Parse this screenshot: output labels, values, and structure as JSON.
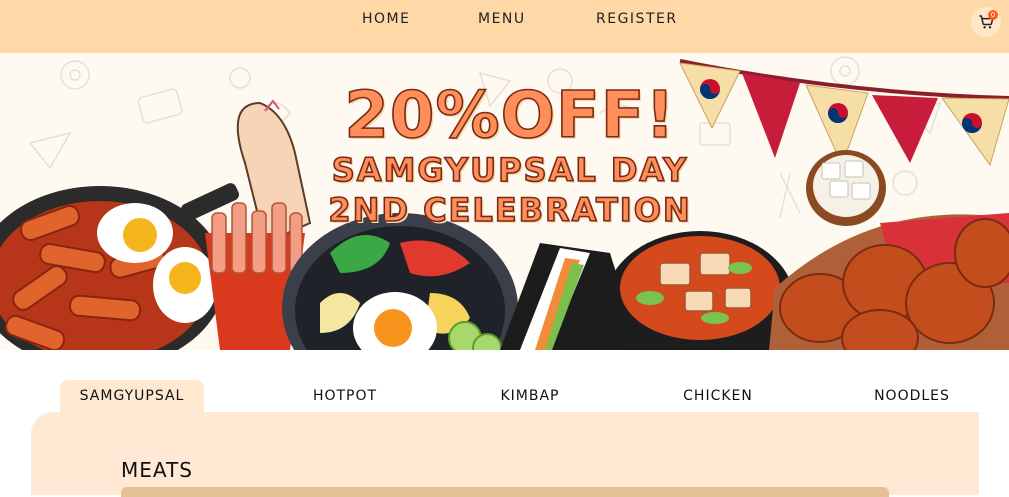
{
  "nav": {
    "links": [
      "HOME",
      "MENU",
      "REGISTER"
    ],
    "cart_count": "0"
  },
  "hero": {
    "title": "20%OFF!",
    "line1": "SAMGYUPSAL DAY",
    "line2": "2ND CELEBRATION"
  },
  "tabs": [
    "SAMGYUPSAL",
    "HOTPOT",
    "KIMBAP",
    "CHICKEN",
    "NOODLES"
  ],
  "active_tab": "SAMGYUPSAL",
  "section": {
    "title": "MEATS"
  },
  "colors": {
    "nav_bg": "#ffd8a8",
    "panel_bg": "#ffe8d4",
    "accent": "#ff8f5a"
  }
}
